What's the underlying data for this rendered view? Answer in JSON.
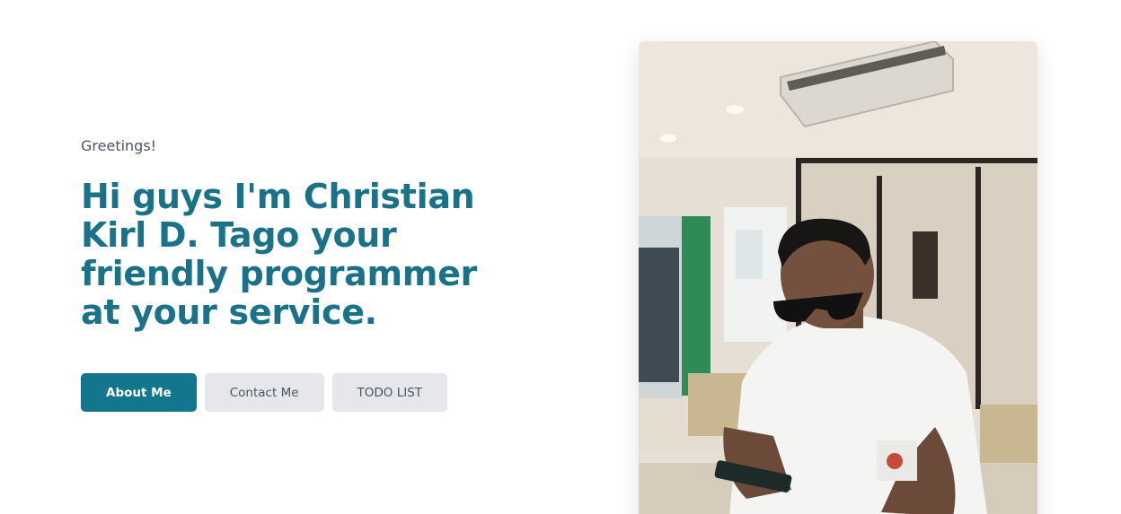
{
  "hero": {
    "greeting": "Greetings!",
    "headline": "Hi guys I'm Christian Kirl D. Tago your friendly programmer at your service."
  },
  "buttons": {
    "about": "About Me",
    "contact": "Contact Me",
    "todo": "TODO LIST"
  },
  "colors": {
    "accent": "#13768d",
    "headline": "#1a7289",
    "secondary_button": "#e5e7eb"
  }
}
